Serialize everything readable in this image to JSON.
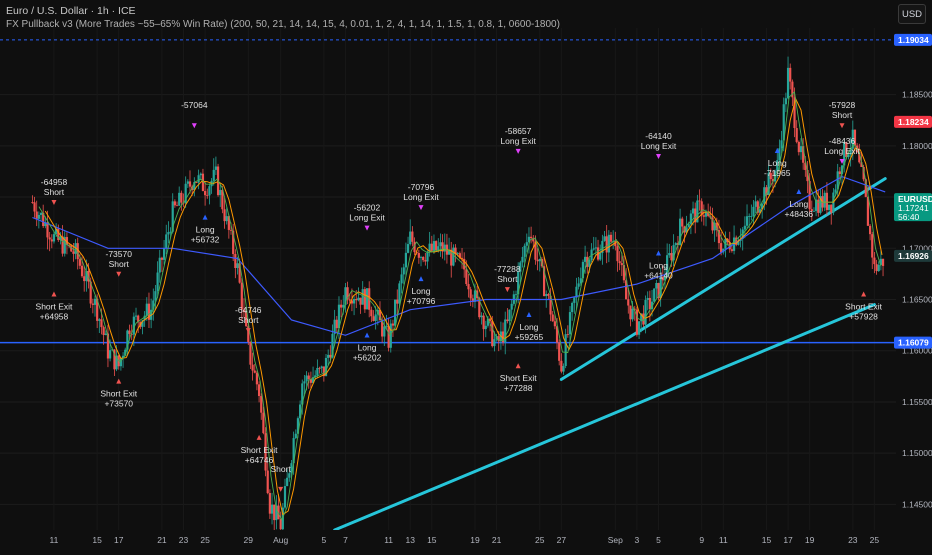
{
  "header": {
    "title": "Euro / U.S. Dollar · 1h · ICE",
    "indicator": "FX Pullback v3 (More Trades ~55–65% Win Rate) (200, 50, 21, 14, 14, 15, 4, 0.01, 1, 2, 4, 1, 14, 1, 1.5, 1, 0.8, 1, 0600-1800)",
    "currency_button": "USD"
  },
  "colors": {
    "background": "#0f0f0f",
    "up": "#26a69a",
    "down": "#ef5350",
    "ema_blue": "#3d5afe",
    "ema_orange": "#ff9800",
    "ema_green": "#4caf50",
    "trendline": "#26c6da",
    "level_line": "#2962ff",
    "marker": "#e040fb",
    "long_arrow": "#2962ff",
    "short_arrow": "#ef5350"
  },
  "price_scale": [
    "1.18500",
    "1.18000",
    "1.17500",
    "1.17000",
    "1.16500",
    "1.16000",
    "1.15500",
    "1.15000",
    "1.14500"
  ],
  "price_badges": [
    {
      "value": "1.19034",
      "color": "#2962ff"
    },
    {
      "value": "1.18234",
      "color": "#f23645"
    },
    {
      "value": "EURUSD",
      "sub": "1.17241",
      "sub2": "56:40",
      "color": "#089981"
    },
    {
      "value": "1.16926",
      "color": "#1e3a3a"
    },
    {
      "value": "1.16079",
      "color": "#2962ff"
    }
  ],
  "time_axis": [
    "11",
    "15",
    "17",
    "21",
    "23",
    "25",
    "29",
    "Aug",
    "5",
    "7",
    "11",
    "13",
    "15",
    "19",
    "21",
    "25",
    "27",
    "Sep",
    "3",
    "5",
    "9",
    "11",
    "15",
    "17",
    "19",
    "23",
    "25"
  ],
  "chart_data": {
    "type": "candlestick",
    "timeframe": "1h",
    "symbol": "EURUSD",
    "ylim": [
      1.1425,
      1.1915
    ],
    "hlines": [
      1.19034,
      1.16079
    ],
    "trendlines": [
      {
        "from": [
          "Aug 6",
          1.1425
        ],
        "to": [
          "Sep 25",
          1.1645
        ]
      },
      {
        "from": [
          "Aug 27",
          1.1572
        ],
        "to": [
          "Sep 26",
          1.1768
        ]
      }
    ],
    "close_path": [
      [
        "Jul 9",
        1.1745
      ],
      [
        "Jul 11",
        1.171
      ],
      [
        "Jul 13",
        1.1695
      ],
      [
        "Jul 15",
        1.164
      ],
      [
        "Jul 16",
        1.16
      ],
      [
        "Jul 17",
        1.1585
      ],
      [
        "Jul 18",
        1.1625
      ],
      [
        "Jul 20",
        1.164
      ],
      [
        "Jul 21",
        1.169
      ],
      [
        "Jul 22",
        1.1735
      ],
      [
        "Jul 23",
        1.175
      ],
      [
        "Jul 24",
        1.177
      ],
      [
        "Jul 25",
        1.176
      ],
      [
        "Jul 26",
        1.177
      ],
      [
        "Jul 28",
        1.168
      ],
      [
        "Jul 29",
        1.16
      ],
      [
        "Jul 30",
        1.156
      ],
      [
        "Jul 31",
        1.145
      ],
      [
        "Aug 1",
        1.143
      ],
      [
        "Aug 3",
        1.157
      ],
      [
        "Aug 5",
        1.158
      ],
      [
        "Aug 7",
        1.166
      ],
      [
        "Aug 9",
        1.165
      ],
      [
        "Aug 11",
        1.161
      ],
      [
        "Aug 12",
        1.166
      ],
      [
        "Aug 13",
        1.171
      ],
      [
        "Aug 14",
        1.1695
      ],
      [
        "Aug 16",
        1.17
      ],
      [
        "Aug 18",
        1.168
      ],
      [
        "Aug 19",
        1.165
      ],
      [
        "Aug 21",
        1.1605
      ],
      [
        "Aug 22",
        1.1625
      ],
      [
        "Aug 24",
        1.172
      ],
      [
        "Aug 26",
        1.164
      ],
      [
        "Aug 27",
        1.1585
      ],
      [
        "Aug 29",
        1.169
      ],
      [
        "Sep 1",
        1.171
      ],
      [
        "Sep 2",
        1.165
      ],
      [
        "Sep 3",
        1.1625
      ],
      [
        "Sep 5",
        1.166
      ],
      [
        "Sep 7",
        1.172
      ],
      [
        "Sep 9",
        1.174
      ],
      [
        "Sep 11",
        1.17
      ],
      [
        "Sep 13",
        1.172
      ],
      [
        "Sep 15",
        1.176
      ],
      [
        "Sep 16",
        1.178
      ],
      [
        "Sep 17",
        1.187
      ],
      [
        "Sep 18",
        1.18
      ],
      [
        "Sep 19",
        1.1745
      ],
      [
        "Sep 21",
        1.1745
      ],
      [
        "Sep 22",
        1.179
      ],
      [
        "Sep 23",
        1.1805
      ],
      [
        "Sep 24",
        1.176
      ],
      [
        "Sep 25",
        1.168
      ],
      [
        "Sep 26",
        1.169
      ]
    ],
    "ema_blue_path": [
      [
        "Jul 9",
        1.173
      ],
      [
        "Jul 16",
        1.17
      ],
      [
        "Jul 22",
        1.17
      ],
      [
        "Jul 28",
        1.169
      ],
      [
        "Aug 2",
        1.163
      ],
      [
        "Aug 7",
        1.1615
      ],
      [
        "Aug 13",
        1.164
      ],
      [
        "Aug 20",
        1.165
      ],
      [
        "Aug 27",
        1.165
      ],
      [
        "Sep 3",
        1.1665
      ],
      [
        "Sep 10",
        1.169
      ],
      [
        "Sep 17",
        1.174
      ],
      [
        "Sep 22",
        1.177
      ],
      [
        "Sep 26",
        1.1755
      ]
    ],
    "signals": [
      {
        "label": "-64958",
        "sub": "Short",
        "at": [
          "Jul 11",
          1.175
        ],
        "side": "above"
      },
      {
        "label": "Short Exit",
        "sub": "+64958",
        "at": [
          "Jul 11",
          1.165
        ],
        "side": "below"
      },
      {
        "label": "-73570",
        "sub": "Short",
        "at": [
          "Jul 17",
          1.168
        ],
        "side": "above"
      },
      {
        "label": "Short Exit",
        "sub": "+73570",
        "at": [
          "Jul 17",
          1.1565
        ],
        "side": "below"
      },
      {
        "label": "-57064",
        "sub": "",
        "at": [
          "Jul 24",
          1.1825
        ],
        "side": "above"
      },
      {
        "label": "Long",
        "sub": "+56732",
        "at": [
          "Jul 25",
          1.1725
        ],
        "side": "below"
      },
      {
        "label": "-64746",
        "sub": "Short",
        "at": [
          "Jul 29",
          1.1625
        ],
        "side": "above"
      },
      {
        "label": "Short Exit",
        "sub": "+64746",
        "at": [
          "Jul 30",
          1.151
        ],
        "side": "below"
      },
      {
        "label": "Short",
        "sub": "",
        "at": [
          "Aug 1",
          1.147
        ],
        "side": "above"
      },
      {
        "label": "-56202",
        "sub": "Long Exit",
        "at": [
          "Aug 9",
          1.1725
        ],
        "side": "above"
      },
      {
        "label": "Long",
        "sub": "+56202",
        "at": [
          "Aug 9",
          1.161
        ],
        "side": "below"
      },
      {
        "label": "-70796",
        "sub": "Long Exit",
        "at": [
          "Aug 14",
          1.1745
        ],
        "side": "above"
      },
      {
        "label": "Long",
        "sub": "+70796",
        "at": [
          "Aug 14",
          1.1665
        ],
        "side": "below"
      },
      {
        "label": "-58657",
        "sub": "Long Exit",
        "at": [
          "Aug 23",
          1.18
        ],
        "side": "above"
      },
      {
        "label": "-77288",
        "sub": "Short",
        "at": [
          "Aug 22",
          1.1665
        ],
        "side": "above"
      },
      {
        "label": "Long",
        "sub": "+59265",
        "at": [
          "Aug 24",
          1.163
        ],
        "side": "below"
      },
      {
        "label": "Short Exit",
        "sub": "+77288",
        "at": [
          "Aug 23",
          1.158
        ],
        "side": "below"
      },
      {
        "label": "-64140",
        "sub": "Long Exit",
        "at": [
          "Sep 5",
          1.1795
        ],
        "side": "above"
      },
      {
        "label": "Long",
        "sub": "+64140",
        "at": [
          "Sep 5",
          1.169
        ],
        "side": "below"
      },
      {
        "label": "Long",
        "sub": "-71965",
        "at": [
          "Sep 16",
          1.179
        ],
        "side": "below"
      },
      {
        "label": "Long",
        "sub": "+48436",
        "at": [
          "Sep 18",
          1.175
        ],
        "side": "below"
      },
      {
        "label": "-57928",
        "sub": "Short",
        "at": [
          "Sep 22",
          1.1825
        ],
        "side": "above"
      },
      {
        "label": "-48436",
        "sub": "Long Exit",
        "at": [
          "Sep 22",
          1.179
        ],
        "side": "above"
      },
      {
        "label": "Short Exit",
        "sub": "+57928",
        "at": [
          "Sep 24",
          1.165
        ],
        "side": "below"
      }
    ]
  }
}
